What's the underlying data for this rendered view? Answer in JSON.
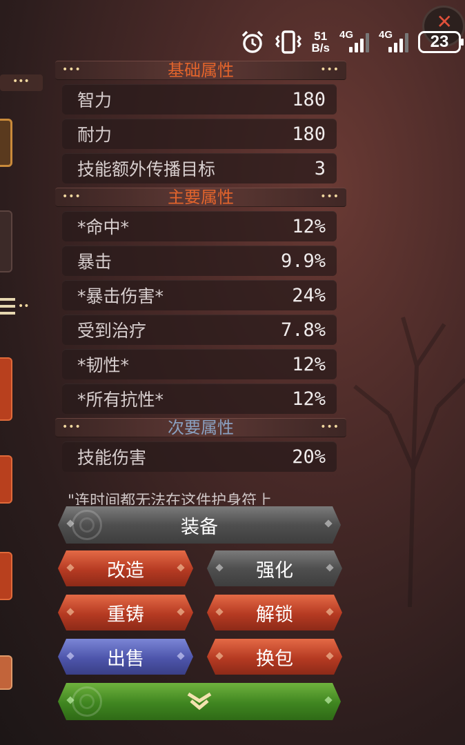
{
  "status_bar": {
    "net_speed_value": "51",
    "net_speed_unit": "B/s",
    "sim1_label": "4G",
    "sim2_label": "4G",
    "battery": "23",
    "icons": [
      "alarm-icon",
      "vibrate-icon",
      "signal-icon",
      "battery-icon"
    ]
  },
  "sections": [
    {
      "title": "基础属性",
      "title_color": "#e2642c",
      "stats": [
        {
          "name": "智力",
          "value": "180"
        },
        {
          "name": "耐力",
          "value": "180"
        },
        {
          "name": "技能额外传播目标",
          "value": "3"
        }
      ]
    },
    {
      "title": "主要属性",
      "title_color": "#e2642c",
      "stats": [
        {
          "name": "*命中*",
          "value": "12%"
        },
        {
          "name": "暴击",
          "value": "9.9%"
        },
        {
          "name": "*暴击伤害*",
          "value": "24%"
        },
        {
          "name": "受到治疗",
          "value": "7.8%"
        },
        {
          "name": "*韧性*",
          "value": "12%"
        },
        {
          "name": "*所有抗性*",
          "value": "12%"
        }
      ]
    },
    {
      "title": "次要属性",
      "title_color": "#8aa0c0",
      "stats": [
        {
          "name": "技能伤害",
          "value": "20%"
        }
      ]
    }
  ],
  "flavor_text": "\"连时间都无法在这件护身符上",
  "buttons": {
    "equip": "装备",
    "reforge": "改造",
    "enhance": "强化",
    "recast": "重铸",
    "unlock": "解锁",
    "sell": "出售",
    "swap_bag": "换包",
    "expand": "chevron-down-icon"
  },
  "colors": {
    "gray_button": "#5a5a5a",
    "orange_button": "#c2442a",
    "purple_button": "#565ebb",
    "green_button": "#4a8f28"
  }
}
